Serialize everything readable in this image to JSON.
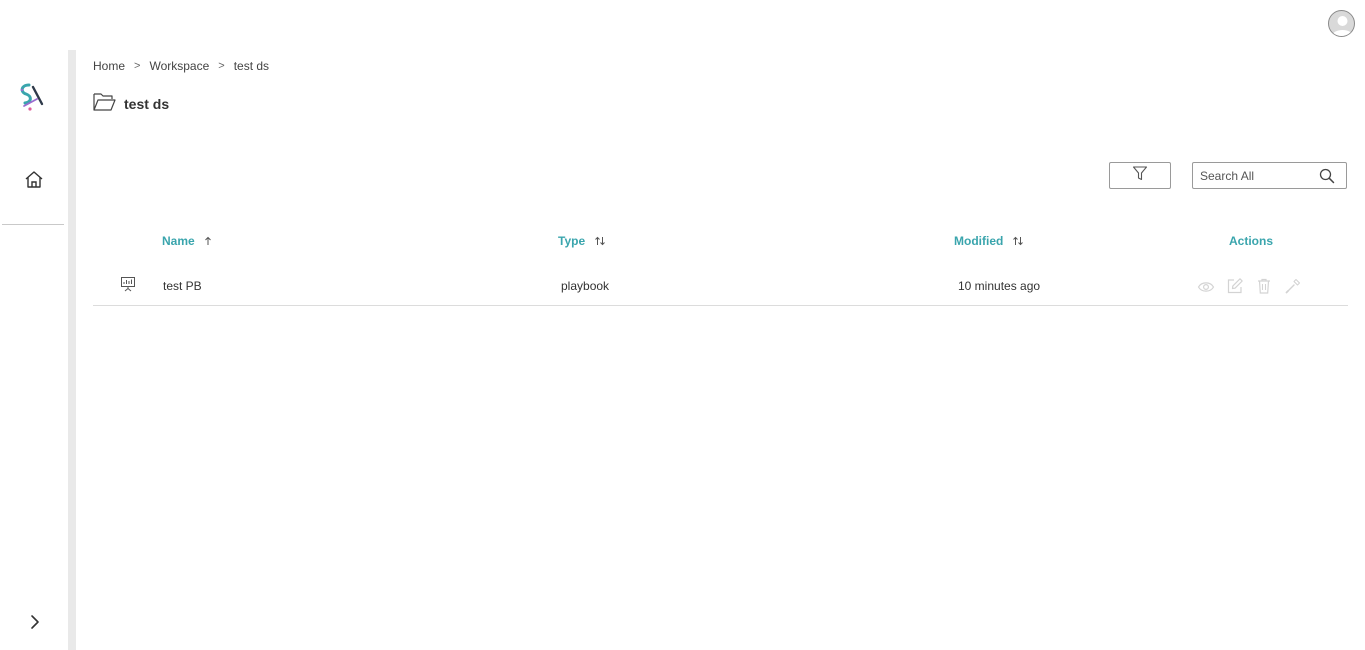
{
  "header": {
    "avatar_icon": "user-avatar-icon"
  },
  "sidebar": {
    "logo_icon": "app-logo-icon",
    "home_icon": "home-icon",
    "expand_icon": "chevron-right-icon"
  },
  "breadcrumb": {
    "items": [
      "Home",
      "Workspace",
      "test ds"
    ],
    "separator": ">"
  },
  "page": {
    "title": "test ds",
    "folder_icon": "folder-open-icon"
  },
  "toolbar": {
    "filter_icon": "filter-icon",
    "search_placeholder": "Search All",
    "search_value": ""
  },
  "table": {
    "columns": [
      {
        "label": "Name",
        "sort": "ascending"
      },
      {
        "label": "Type",
        "sort": "unsorted"
      },
      {
        "label": "Modified",
        "sort": "unsorted"
      },
      {
        "label": "Actions",
        "sort": "none"
      }
    ],
    "rows": [
      {
        "icon": "presentation-board-icon",
        "name": "test PB",
        "type": "playbook",
        "modified": "10 minutes ago",
        "actions": [
          "view-icon",
          "edit-icon",
          "delete-icon",
          "link-icon"
        ]
      }
    ]
  },
  "colors": {
    "accent": "#3aa5ad",
    "rail": "#e9e9e9",
    "border": "#9a9a9a",
    "action_icons": "#cfcfcf"
  }
}
